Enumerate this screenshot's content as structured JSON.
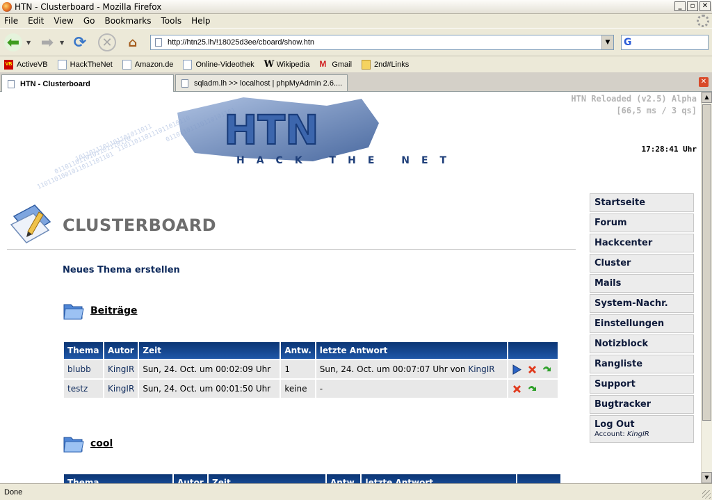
{
  "window": {
    "title": "HTN - Clusterboard - Mozilla Firefox"
  },
  "menu": [
    "File",
    "Edit",
    "View",
    "Go",
    "Bookmarks",
    "Tools",
    "Help"
  ],
  "address": {
    "url": "http://htn25.lh/!18025d3ee/cboard/show.htn"
  },
  "bookmarks": [
    "ActiveVB",
    "HackTheNet",
    "Amazon.de",
    "Online-Videothek",
    "Wikipedia",
    "Gmail",
    "2nd#Links"
  ],
  "tabs": [
    "HTN - Clusterboard",
    "sqladm.lh >> localhost | phpMyAdmin 2.6...."
  ],
  "status": "Done",
  "page": {
    "version": "HTN Reloaded (v2.5) Alpha",
    "timing": "[66,5 ms / 3 qs]",
    "clock": "17:28:41 Uhr",
    "logo_text": "HTN",
    "logo_sub": "HACK THE NET",
    "title": "CLUSTERBOARD",
    "new_topic": "Neues Thema erstellen",
    "sections": [
      {
        "name": "Beiträge",
        "headers": [
          "Thema",
          "Autor",
          "Zeit",
          "Antw.",
          "letzte Antwort",
          ""
        ],
        "rows": [
          {
            "thema": "blubb",
            "autor": "KingIR",
            "zeit": "Sun, 24. Oct. um 00:02:09 Uhr",
            "antw": "1",
            "letzte": "Sun, 24. Oct. um 00:07:07 Uhr von ",
            "letzte_by": "KingIR"
          },
          {
            "thema": "testz",
            "autor": "KingIR",
            "zeit": "Sun, 24. Oct. um 00:01:50 Uhr",
            "antw": "keine",
            "letzte": "-",
            "letzte_by": ""
          }
        ]
      },
      {
        "name": "cool",
        "headers": [
          "Thema",
          "Autor",
          "Zeit",
          "Antw.",
          "letzte Antwort",
          ""
        ]
      }
    ],
    "sidebar": [
      "Startseite",
      "Forum",
      "Hackcenter",
      "Cluster",
      "Mails",
      "System-Nachr.",
      "Einstellungen",
      "Notizblock",
      "Rangliste",
      "Support",
      "Bugtracker"
    ],
    "logout": {
      "label": "Log Out",
      "account_label": "Account: ",
      "account": "KingIR"
    }
  }
}
